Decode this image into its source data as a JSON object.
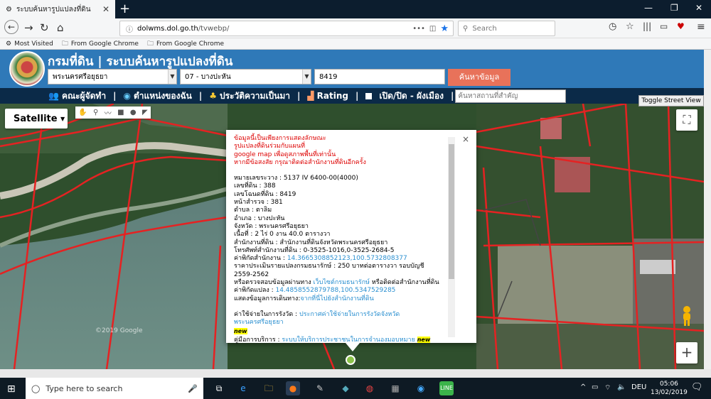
{
  "browser": {
    "tab_title": "ระบบค้นหารูปแปลงที่ดิน",
    "url_host": "dolwms.dol.go.th",
    "url_path": "/tvwebp/",
    "search_placeholder": "Search",
    "bookmarks": [
      "Most Visited",
      "From Google Chrome",
      "From Google Chrome"
    ]
  },
  "site": {
    "title": "กรมที่ดิน | ระบบค้นหารูปแปลงที่ดิน",
    "province_select": "พระนครศรีอยุธยา",
    "district_select": "07 - บางปะหัน",
    "parcel_number": "8419",
    "search_button": "ค้นหาข้อมูล",
    "menu": {
      "team": "คณะผู้จัดทำ",
      "location": "ตำแหน่งของฉัน",
      "history": "ประวัติความเป็นมา",
      "rating": "Rating",
      "toggle_plan": "เปิด/ปิด - ผังเมือง",
      "place_search_placeholder": "ค้นหาสถานที่สำคัญ"
    }
  },
  "map": {
    "map_type": "Satellite",
    "toggle_street_view": "Toggle Street View",
    "watermark": "©2019 Google",
    "zoom_in": "+",
    "fullscreen": "⛶"
  },
  "infowindow": {
    "notice": [
      "ข้อมูลนี้เป็นเพียงการแสดงลักษณะ",
      "รูปแปลงที่ดินร่วมกับแผนที่",
      "google map เพื่อดูสภาพพื้นที่เท่านั้น",
      "หากมีข้อสงสัย กรุณาติดต่อสำนักงานที่ดินอีกครั้ง"
    ],
    "fields": [
      {
        "label": "หมายเลขระวาง : ",
        "value": "5137 IV 6400-00(4000)"
      },
      {
        "label": "เลขที่ดิน : ",
        "value": "388"
      },
      {
        "label": "เลขโฉนดที่ดิน : ",
        "value": "8419"
      },
      {
        "label": "หน้าสำรวจ : ",
        "value": "381"
      },
      {
        "label": "ตำบล : ",
        "value": "ตาลิม"
      },
      {
        "label": "อำเภอ : ",
        "value": "บางปะหัน"
      },
      {
        "label": "จังหวัด : ",
        "value": "พระนครศรีอยุธยา"
      },
      {
        "label": "เนื้อที่ : ",
        "value": "2 ไร่ 0 งาน 40.0 ตารางวา"
      },
      {
        "label": "สำนักงานที่ดิน : ",
        "value": "สำนักงานที่ดินจังหวัดพระนครศรีอยุธยา"
      },
      {
        "label": "โทรศัพท์สำนักงานที่ดิน : ",
        "value": "0-3525-1016,0-3525-2684-5"
      }
    ],
    "office_coord_label": "ค่าพิกัดสำนักงาน : ",
    "office_coord": "14.3665308852123,100.5732808377",
    "price_line1": "ราคาประเมินรายแปลงกรมธนารักษ์ : 250 บาทต่อตารางวา รอบบัญชี",
    "price_line2": "2559-2562",
    "check_prefix": "หรือตรวจสอบข้อมูลผ่านทาง ",
    "check_link": "เว็บไซต์กรมธนารักษ์",
    "check_suffix": " หรือติดต่อสำนักงานที่ดิน",
    "parcel_coord_label": "ค่าพิกัดแปลง : ",
    "parcel_coord": "14.4858552879788,100.5347529285",
    "route_label": "แสดงข้อมูลการเดินทาง:",
    "route_link": "จากที่นี่ไปยังสำนักงานที่ดิน",
    "fee_label": "ค่าใช้จ่ายในการรังวัด : ",
    "fee_link": "ประกาศค่าใช้จ่ายในการรังวัดจังหวัดพระนครศรีอยุธยา",
    "new_badge": "new",
    "guide_label": "คู่มือการบริการ : ",
    "guide_link": "ระบบให้บริการประชาชนในการจำนองมอบหมาย",
    "close": "×"
  },
  "taskbar": {
    "search_placeholder": "Type here to search",
    "lang": "DEU",
    "time": "05:06",
    "date": "13/02/2019"
  }
}
